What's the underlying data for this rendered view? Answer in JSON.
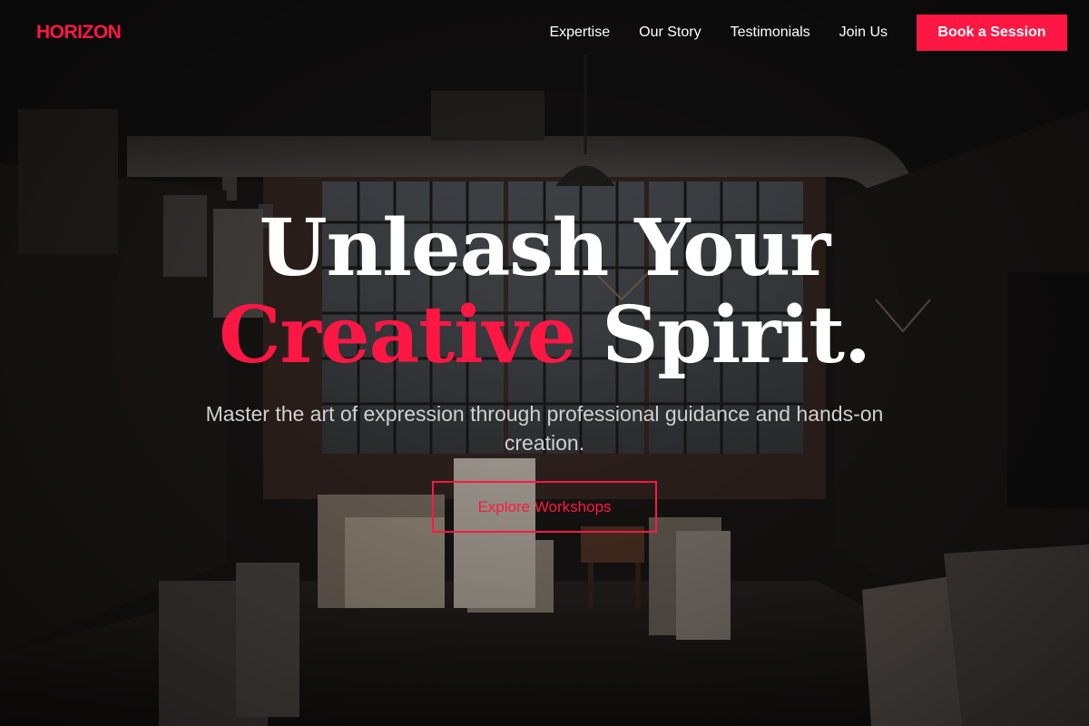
{
  "brand": {
    "logo": "HORIZON"
  },
  "nav": {
    "links": [
      "Expertise",
      "Our Story",
      "Testimonials",
      "Join Us"
    ],
    "cta_label": "Book a Session"
  },
  "hero": {
    "headline_line1": "Unleash Your",
    "headline_accent": "Creative",
    "headline_rest": "Spirit.",
    "subtitle": "Master the art of expression through professional guidance and hands-on creation.",
    "button_label": "Explore Workshops",
    "background_image": "art studio interior"
  },
  "colors": {
    "accent": "#ff1744",
    "text": "#ffffff",
    "subtitle": "#d0d0d0",
    "overlay": "#000000"
  }
}
